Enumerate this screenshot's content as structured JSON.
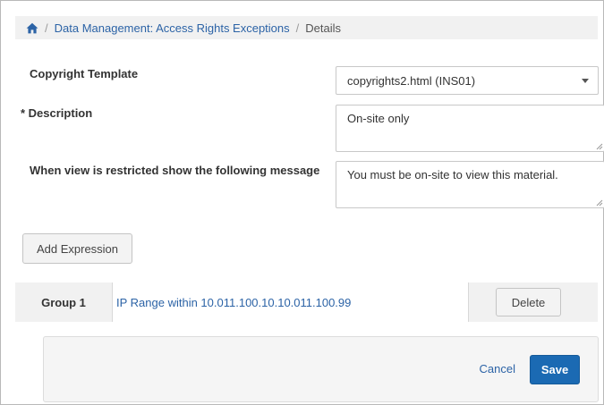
{
  "breadcrumb": {
    "home_icon": "home-icon",
    "separator": "/",
    "link_label": "Data Management: Access Rights Exceptions",
    "current_label": "Details"
  },
  "form": {
    "copyright_template": {
      "label": "Copyright Template",
      "value": "copyrights2.html (INS01)",
      "icon": "caret-down-icon"
    },
    "description": {
      "label": "* Description",
      "value": "On-site only"
    },
    "restricted_message": {
      "label": "When view is restricted show the following message",
      "value": "You must be on-site to view this material."
    }
  },
  "add_expression_label": "Add Expression",
  "group": {
    "label": "Group 1",
    "expression": "IP Range within 10.011.100.10.10.011.100.99",
    "delete_label": "Delete"
  },
  "footer": {
    "cancel_label": "Cancel",
    "save_label": "Save"
  },
  "colors": {
    "link": "#2c63a6",
    "primary_button": "#1b6ab3",
    "breadcrumb_bg": "#f1f1f1"
  }
}
